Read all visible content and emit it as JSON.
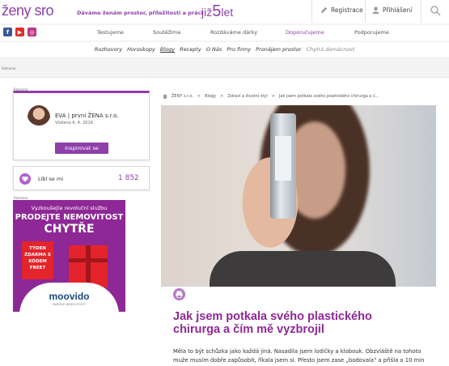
{
  "header": {
    "logo": "ženy sro",
    "tagline": "Dáváme ženám prostor, příležitosti a práci",
    "anniversary_prefix": "již",
    "anniversary_number": "5",
    "anniversary_suffix": "let",
    "register_label": "Registrace",
    "login_label": "Přihlášení"
  },
  "social": {
    "facebook": "f",
    "youtube": "▶",
    "instagram": "◎"
  },
  "nav": {
    "items": [
      "Testujeme",
      "Soutěžíme",
      "Rozdáváme dárky",
      "Doporučujeme",
      "Podporujeme"
    ],
    "active": "Doporučujeme"
  },
  "subnav": {
    "items": [
      "Rozhovory",
      "Horoskopy",
      "Blogy",
      "Recepty",
      "O Nás",
      "Pro firmy",
      "Pronájem prostor"
    ],
    "extra": "Chytrá domácnost"
  },
  "ad_label": "Reklama",
  "author": {
    "name": "EVA | první ŽENA s.r.o.",
    "date": "Vloženo 6. 4. 2019",
    "button": "Inspirovat se"
  },
  "likes": {
    "label": "Líbí se mi",
    "count": "1 852"
  },
  "ad": {
    "line1": "Vyzkoušejte revoluční službu",
    "line2": "PRODEJTE NEMOVITOST",
    "line3": "CHYTŘE",
    "badge": "TÝDEN ZDARMA S KÓDEM FREE7",
    "brand": "moovido",
    "brand_sub": "INZERCE NEMOVITOSTÍ"
  },
  "breadcrumb": {
    "items": [
      "ŽENY s.r.o.",
      "Blogy",
      "Zdraví a životní styl",
      "Jak jsem potkala svého plastického chirurga a č..."
    ],
    "separator": ">"
  },
  "article": {
    "title": "Jak jsem potkala svého plastického chirurga a čím mě vyzbrojil",
    "perex": "Měla to být schůzka jako každá jiná. Nasadila jsem lodičky a klobouk. Obzvláště na tohoto muže musím dobře zapůsobit, říkala jsem si. Přesto jsem zase „bodovala\" a přišla o 10 min"
  },
  "colors": {
    "brand": "#8e3fa8",
    "ad_bg": "#8e2896",
    "ad_red": "#e3252b"
  }
}
